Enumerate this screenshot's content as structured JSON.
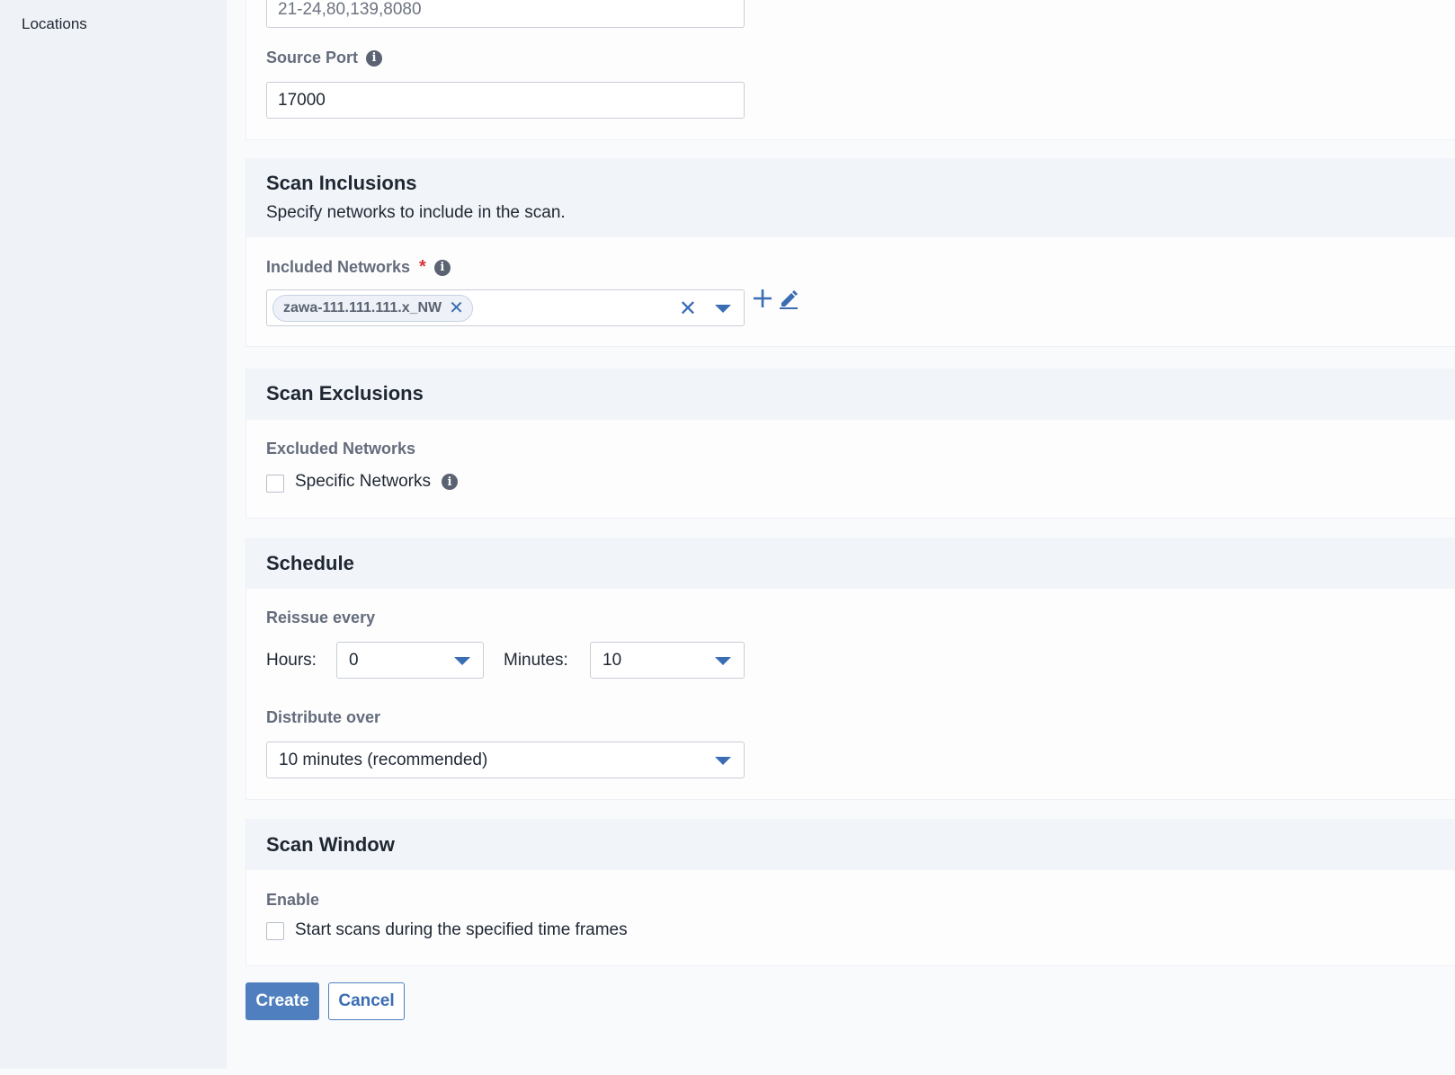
{
  "sidebar": {
    "items": [
      {
        "label": "Locations"
      }
    ]
  },
  "ports": {
    "target_ports_value": "21-24,80,139,8080",
    "source_port_label": "Source Port",
    "source_port_value": "17000"
  },
  "inclusions": {
    "title": "Scan Inclusions",
    "description": "Specify networks to include in the scan.",
    "included_networks_label": "Included Networks",
    "required_mark": "*",
    "selected_tags": [
      "zawa-111.111.111.x_NW"
    ]
  },
  "exclusions": {
    "title": "Scan Exclusions",
    "excluded_networks_label": "Excluded Networks",
    "specific_networks_label": "Specific Networks",
    "specific_networks_checked": false
  },
  "schedule": {
    "title": "Schedule",
    "reissue_label": "Reissue every",
    "hours_label": "Hours:",
    "hours_value": "0",
    "minutes_label": "Minutes:",
    "minutes_value": "10",
    "distribute_label": "Distribute over",
    "distribute_value": "10 minutes (recommended)"
  },
  "scan_window": {
    "title": "Scan Window",
    "enable_label": "Enable",
    "start_scans_label": "Start scans during the specified time frames",
    "start_scans_checked": false
  },
  "actions": {
    "create_label": "Create",
    "cancel_label": "Cancel"
  },
  "icons": {
    "info": "info-icon",
    "add": "plus-icon",
    "edit": "pencil-icon",
    "remove": "close-icon",
    "dropdown": "caret-down-icon"
  },
  "colors": {
    "accent": "#3a6db3",
    "primary_button": "#4f7fbe",
    "required": "#d9323b",
    "section_header_bg": "#f1f4f8",
    "sidebar_bg": "#eff2f6"
  }
}
